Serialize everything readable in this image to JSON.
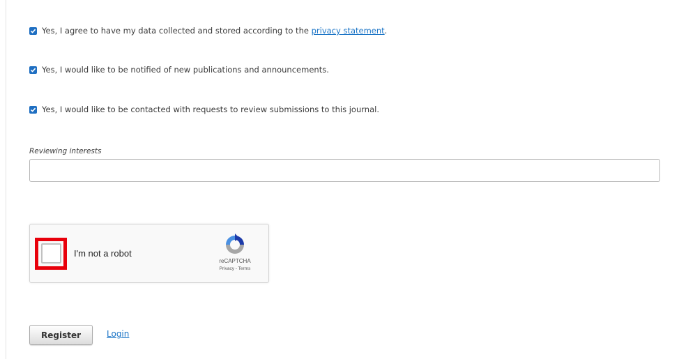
{
  "consents": [
    {
      "prefix": "Yes, I agree to have my data collected and stored according to the ",
      "link_text": "privacy statement",
      "suffix": ".",
      "checked": true
    },
    {
      "text": "Yes, I would like to be notified of new publications and announcements.",
      "checked": true
    },
    {
      "text": "Yes, I would like to be contacted with requests to review submissions to this journal.",
      "checked": true
    }
  ],
  "reviewing_interests": {
    "label": "Reviewing interests",
    "value": ""
  },
  "recaptcha": {
    "label": "I'm not a robot",
    "brand": "reCAPTCHA",
    "links": "Privacy - Terms",
    "checked": false,
    "highlight_color": "#e8000b"
  },
  "actions": {
    "register_label": "Register",
    "login_label": "Login"
  },
  "colors": {
    "checkbox": "#1f6fc2",
    "link": "#1a74c6"
  },
  "icons": [
    "checkmark-icon",
    "recaptcha-logo-icon"
  ]
}
